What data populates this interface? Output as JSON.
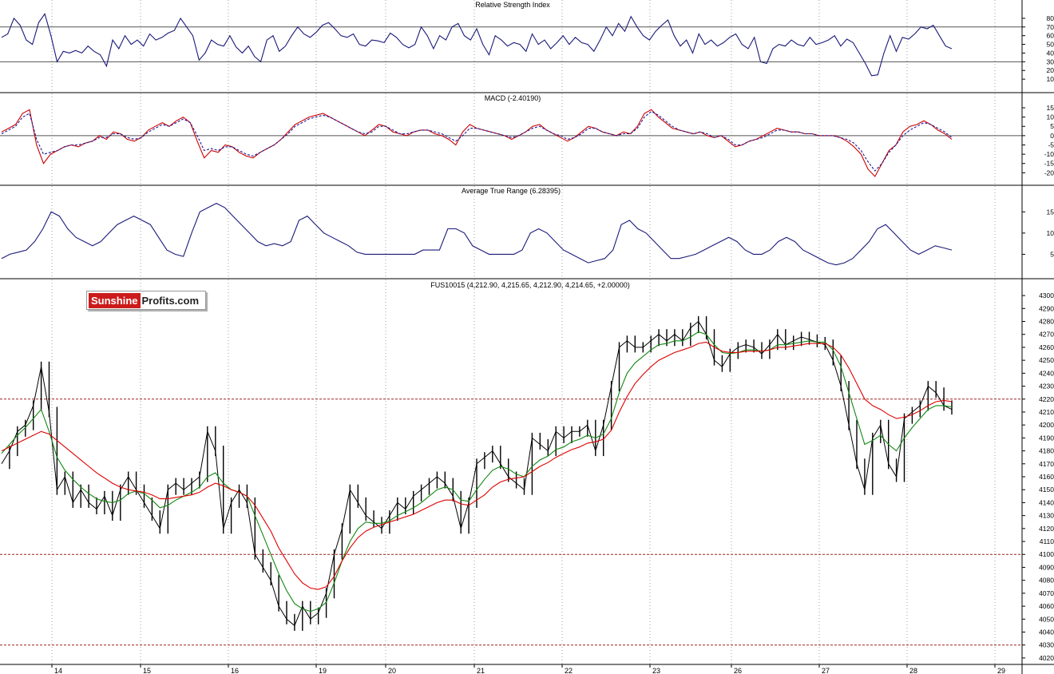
{
  "colors": {
    "background": "#ffffff",
    "grid": "#a0a0a0",
    "rsi_line": "#1a1a7a",
    "macd_line": "#cc0000",
    "signal_line": "#1a1a9a",
    "atr_line": "#1a1a7a",
    "price_bars": "#000000",
    "ma_fast": "#118811",
    "ma_slow": "#dd0000",
    "support_lines": "#a02020"
  },
  "logo": {
    "part1": "Sunshine",
    "part2": "Profits.com"
  },
  "chart_data": [
    {
      "type": "line",
      "title": "Relative Strength Index",
      "ylim": [
        0,
        90
      ],
      "yticks": [
        "10",
        "20",
        "30",
        "40",
        "50",
        "60",
        "70",
        "80"
      ],
      "reference_levels": [
        30,
        70
      ],
      "series": [
        {
          "values": [
            58,
            62,
            80,
            72,
            55,
            50,
            75,
            85,
            60,
            30,
            42,
            40,
            43,
            40,
            48,
            42,
            38,
            25,
            55,
            45,
            60,
            50,
            55,
            48,
            62,
            55,
            58,
            63,
            66,
            80,
            70,
            60,
            32,
            40,
            55,
            50,
            48,
            60,
            47,
            40,
            48,
            36,
            30,
            55,
            60,
            42,
            48,
            60,
            70,
            62,
            58,
            64,
            72,
            75,
            68,
            60,
            58,
            62,
            50,
            48,
            55,
            54,
            52,
            63,
            58,
            50,
            46,
            50,
            70,
            60,
            45,
            60,
            55,
            70,
            74,
            60,
            55,
            68,
            50,
            38,
            60,
            55,
            48,
            52,
            50,
            42,
            62,
            50,
            55,
            45,
            52,
            60,
            50,
            58,
            52,
            50,
            42,
            55,
            70,
            60,
            74,
            65,
            82,
            70,
            60,
            55,
            65,
            72,
            78,
            60,
            48,
            55,
            40,
            62,
            50,
            55,
            48,
            52,
            58,
            62,
            50,
            45,
            58,
            30,
            28,
            45,
            50,
            48,
            55,
            50,
            48,
            58,
            50,
            52,
            55,
            60,
            48,
            56,
            52,
            40,
            28,
            14,
            15,
            40,
            60,
            42,
            58,
            56,
            62,
            70,
            68,
            72,
            60,
            48,
            45
          ]
        }
      ]
    },
    {
      "type": "line",
      "title": "MACD (-2.40190)",
      "ylim": [
        -25,
        18
      ],
      "yticks": [
        "-20",
        "-15",
        "-10",
        "-5",
        "0",
        "5",
        "10",
        "15"
      ],
      "reference_levels": [
        0
      ],
      "series": [
        {
          "values": [
            2,
            4,
            6,
            12,
            14,
            -5,
            -15,
            -10,
            -8,
            -6,
            -5,
            -6,
            -4,
            -3,
            0,
            -2,
            2,
            1,
            -2,
            -3,
            -1,
            3,
            5,
            7,
            5,
            8,
            10,
            7,
            -3,
            -12,
            -8,
            -9,
            -5,
            -6,
            -9,
            -11,
            -12,
            -9,
            -7,
            -5,
            -2,
            2,
            6,
            8,
            10,
            11,
            12,
            10,
            8,
            6,
            4,
            2,
            0,
            3,
            6,
            5,
            2,
            1,
            0,
            2,
            3,
            3,
            1,
            0,
            -2,
            -5,
            2,
            6,
            4,
            3,
            2,
            1,
            0,
            -2,
            0,
            2,
            5,
            6,
            3,
            1,
            -1,
            -3,
            -1,
            2,
            5,
            4,
            2,
            1,
            0,
            2,
            1,
            5,
            12,
            14,
            10,
            7,
            4,
            3,
            2,
            1,
            2,
            0,
            -1,
            0,
            -3,
            -6,
            -5,
            -3,
            -2,
            0,
            2,
            4,
            3,
            2,
            2,
            1,
            1,
            0,
            0,
            0,
            -1,
            -3,
            -6,
            -10,
            -18,
            -22,
            -15,
            -8,
            -5,
            2,
            5,
            6,
            8,
            6,
            3,
            1,
            -2
          ]
        },
        {
          "values": [
            1,
            3,
            5,
            10,
            12,
            -2,
            -10,
            -9,
            -8,
            -6,
            -5,
            -5,
            -4,
            -3,
            -1,
            -1,
            1,
            1,
            -1,
            -2,
            -1,
            2,
            4,
            6,
            5,
            7,
            9,
            7,
            0,
            -8,
            -7,
            -8,
            -6,
            -6,
            -8,
            -10,
            -11,
            -9,
            -7,
            -5,
            -2,
            1,
            5,
            7,
            9,
            10,
            11,
            10,
            8,
            6,
            4,
            2,
            1,
            2,
            5,
            5,
            3,
            1,
            1,
            2,
            3,
            3,
            2,
            1,
            -1,
            -3,
            0,
            4,
            4,
            3,
            2,
            1,
            0,
            -1,
            0,
            2,
            4,
            5,
            3,
            1,
            0,
            -2,
            -1,
            1,
            4,
            4,
            2,
            1,
            0,
            1,
            1,
            4,
            10,
            13,
            11,
            8,
            5,
            3,
            2,
            1,
            2,
            1,
            -1,
            0,
            -2,
            -5,
            -5,
            -3,
            -2,
            -1,
            1,
            3,
            3,
            2,
            2,
            1,
            1,
            0,
            0,
            0,
            -1,
            -2,
            -4,
            -8,
            -14,
            -19,
            -15,
            -9,
            -5,
            0,
            3,
            5,
            7,
            6,
            4,
            2,
            -1
          ]
        }
      ]
    },
    {
      "type": "line",
      "title": "Average True Range (6.28395)",
      "ylim": [
        0,
        19
      ],
      "yticks": [
        "5",
        "10",
        "15"
      ],
      "series": [
        {
          "values": [
            4,
            5,
            5.5,
            6,
            8,
            11,
            15,
            14,
            11,
            9,
            8,
            7,
            8,
            10,
            12,
            13,
            14,
            13,
            12,
            9,
            6,
            5,
            4.5,
            10,
            15,
            16,
            17,
            16,
            14,
            12,
            10,
            8,
            7,
            7.5,
            7,
            8,
            13,
            14,
            12,
            10,
            9,
            8,
            7,
            5.5,
            5,
            5,
            5,
            5,
            5,
            5,
            5,
            6,
            6,
            6,
            11,
            11,
            10,
            7,
            6,
            5,
            5,
            5,
            5,
            6,
            10,
            11,
            10,
            8,
            6,
            5,
            4,
            3,
            3.5,
            4,
            6,
            12,
            13,
            11,
            10,
            8,
            6,
            4,
            4,
            4.5,
            5,
            6,
            7,
            8,
            9,
            8,
            6,
            5,
            5,
            6,
            8,
            9,
            8,
            6,
            5,
            4,
            3,
            2.5,
            3,
            4,
            6,
            8,
            11,
            12,
            10,
            8,
            6,
            5,
            6,
            7,
            6.5,
            6
          ]
        }
      ]
    },
    {
      "type": "line",
      "title": "FUS10015 (4,212.90, 4,215.65, 4,212.90, 4,214.65, +2.00000)",
      "ylim": [
        4015,
        4305
      ],
      "yticks": [
        "4020",
        "4030",
        "4040",
        "4050",
        "4060",
        "4070",
        "4080",
        "4090",
        "4100",
        "4110",
        "4120",
        "4130",
        "4140",
        "4150",
        "4160",
        "4170",
        "4180",
        "4190",
        "4200",
        "4210",
        "4220",
        "4230",
        "4240",
        "4250",
        "4260",
        "4270",
        "4280",
        "4290",
        "4300"
      ],
      "xticks": [
        "14",
        "15",
        "16",
        "19",
        "20",
        "21",
        "22",
        "23",
        "26",
        "27",
        "28",
        "29"
      ],
      "reference_levels": [
        4220,
        4100,
        4030
      ],
      "series": [
        {
          "values": [
            4170,
            4180,
            4195,
            4200,
            4215,
            4245,
            4210,
            4150,
            4160,
            4140,
            4150,
            4140,
            4135,
            4145,
            4130,
            4150,
            4160,
            4150,
            4140,
            4130,
            4120,
            4150,
            4155,
            4150,
            4155,
            4160,
            4195,
            4180,
            4120,
            4140,
            4150,
            4140,
            4100,
            4090,
            4080,
            4060,
            4050,
            4045,
            4060,
            4050,
            4055,
            4070,
            4100,
            4120,
            4150,
            4140,
            4130,
            4125,
            4120,
            4130,
            4140,
            4135,
            4145,
            4150,
            4155,
            4160,
            4155,
            4145,
            4120,
            4140,
            4170,
            4175,
            4180,
            4170,
            4160,
            4155,
            4150,
            4190,
            4185,
            4180,
            4195,
            4190,
            4195,
            4195,
            4200,
            4180,
            4200,
            4230,
            4260,
            4265,
            4260,
            4260,
            4265,
            4270,
            4265,
            4270,
            4265,
            4275,
            4280,
            4270,
            4250,
            4245,
            4255,
            4260,
            4262,
            4260,
            4255,
            4262,
            4270,
            4262,
            4265,
            4268,
            4266,
            4264,
            4262,
            4250,
            4230,
            4200,
            4170,
            4150,
            4190,
            4200,
            4170,
            4160,
            4205,
            4210,
            4215,
            4230,
            4225,
            4215,
            4212
          ]
        },
        {
          "values": [
            4178,
            4185,
            4192,
            4198,
            4205,
            4212,
            4195,
            4175,
            4165,
            4158,
            4152,
            4147,
            4143,
            4141,
            4140,
            4142,
            4147,
            4149,
            4147,
            4142,
            4136,
            4138,
            4142,
            4145,
            4148,
            4152,
            4160,
            4163,
            4155,
            4150,
            4148,
            4145,
            4130,
            4115,
            4100,
            4085,
            4072,
            4062,
            4058,
            4056,
            4058,
            4063,
            4078,
            4095,
            4110,
            4120,
            4125,
            4124,
            4124,
            4126,
            4130,
            4133,
            4136,
            4140,
            4145,
            4150,
            4152,
            4150,
            4142,
            4141,
            4150,
            4158,
            4165,
            4168,
            4166,
            4162,
            4160,
            4168,
            4173,
            4176,
            4181,
            4183,
            4187,
            4189,
            4192,
            4190,
            4193,
            4205,
            4225,
            4240,
            4248,
            4253,
            4258,
            4262,
            4263,
            4265,
            4265,
            4268,
            4272,
            4270,
            4262,
            4256,
            4255,
            4256,
            4258,
            4258,
            4257,
            4258,
            4262,
            4262,
            4263,
            4264,
            4265,
            4264,
            4264,
            4258,
            4245,
            4225,
            4205,
            4185,
            4188,
            4192,
            4185,
            4180,
            4190,
            4198,
            4205,
            4212,
            4215,
            4215,
            4214
          ]
        },
        {
          "values": [
            4180,
            4183,
            4186,
            4189,
            4192,
            4195,
            4193,
            4188,
            4183,
            4178,
            4173,
            4168,
            4163,
            4159,
            4155,
            4152,
            4150,
            4149,
            4148,
            4146,
            4143,
            4143,
            4144,
            4145,
            4146,
            4148,
            4152,
            4155,
            4153,
            4150,
            4148,
            4145,
            4138,
            4128,
            4118,
            4105,
            4095,
            4085,
            4078,
            4074,
            4073,
            4075,
            4083,
            4095,
            4105,
            4113,
            4118,
            4121,
            4123,
            4125,
            4127,
            4129,
            4131,
            4134,
            4137,
            4140,
            4142,
            4142,
            4139,
            4138,
            4142,
            4146,
            4152,
            4156,
            4158,
            4159,
            4160,
            4164,
            4168,
            4171,
            4175,
            4178,
            4181,
            4183,
            4186,
            4187,
            4189,
            4196,
            4210,
            4222,
            4232,
            4239,
            4245,
            4250,
            4253,
            4256,
            4258,
            4260,
            4263,
            4264,
            4260,
            4257,
            4256,
            4256,
            4257,
            4257,
            4257,
            4258,
            4260,
            4260,
            4261,
            4262,
            4263,
            4263,
            4263,
            4260,
            4254,
            4244,
            4232,
            4220,
            4215,
            4212,
            4208,
            4205,
            4206,
            4208,
            4211,
            4215,
            4218,
            4219,
            4218
          ]
        }
      ]
    }
  ]
}
